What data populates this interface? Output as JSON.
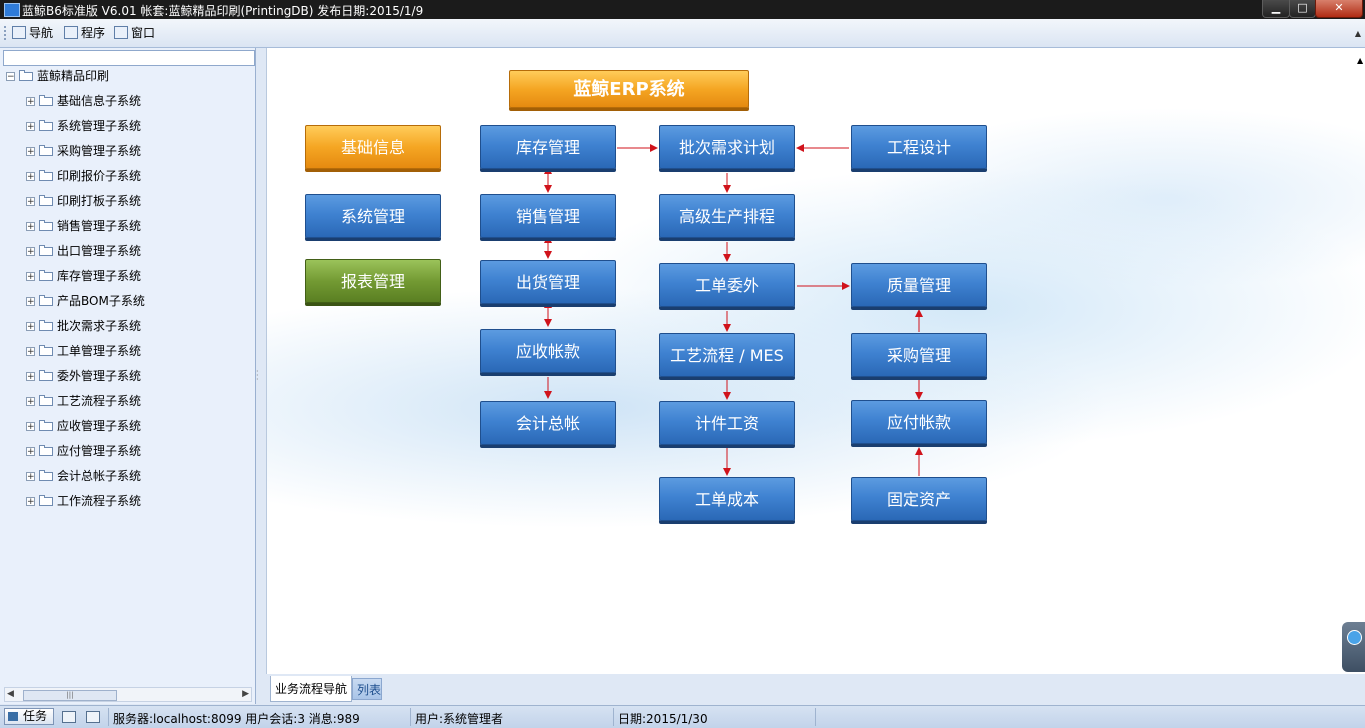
{
  "window": {
    "title": "蓝鲸B6标准版 V6.01 帐套:蓝鲸精品印刷(PrintingDB) 发布日期:2015/1/9",
    "min_glyph": "▁",
    "max_glyph": "□",
    "close_glyph": "✕"
  },
  "menu": {
    "nav": "导航",
    "program": "程序",
    "window": "窗口",
    "scroll_glyph": "▲"
  },
  "tree": {
    "root": "蓝鲸精品印刷",
    "collapse_glyph": "−",
    "expand_glyph": "+",
    "items": [
      "基础信息子系统",
      "系统管理子系统",
      "采购管理子系统",
      "印刷报价子系统",
      "印刷打板子系统",
      "销售管理子系统",
      "出口管理子系统",
      "库存管理子系统",
      "产品BOM子系统",
      "批次需求子系统",
      "工单管理子系统",
      "委外管理子系统",
      "工艺流程子系统",
      "应收管理子系统",
      "应付管理子系统",
      "会计总帐子系统",
      "工作流程子系统"
    ],
    "scroll_left": "◀",
    "scroll_right": "▶",
    "thumb_grip": "|||"
  },
  "flow": {
    "title": "蓝鲸ERP系统",
    "basic_info": "基础信息",
    "system_mgmt": "系统管理",
    "report_mgmt": "报表管理",
    "inventory": "库存管理",
    "sales": "销售管理",
    "shipping": "出货管理",
    "receivables": "应收帐款",
    "ledger": "会计总帐",
    "batch_plan": "批次需求计划",
    "scheduling": "高级生产排程",
    "outsourcing": "工单委外",
    "process_mes": "工艺流程 / MES",
    "piecework": "计件工资",
    "job_cost": "工单成本",
    "engineering": "工程设计",
    "quality": "质量管理",
    "purchasing": "采购管理",
    "payables": "应付帐款",
    "fixed_assets": "固定资产"
  },
  "tabs": {
    "flow_nav": "业务流程导航",
    "list": "列表"
  },
  "status": {
    "task": "任务",
    "server": "服务器:localhost:8099 用户会话:3 消息:989",
    "user": "用户:系统管理者",
    "date": "日期:2015/1/30"
  },
  "colors": {
    "blue_button": "#3f82d1",
    "orange_button": "#f5a623",
    "green_button": "#739a33",
    "arrow": "#d0131b"
  }
}
